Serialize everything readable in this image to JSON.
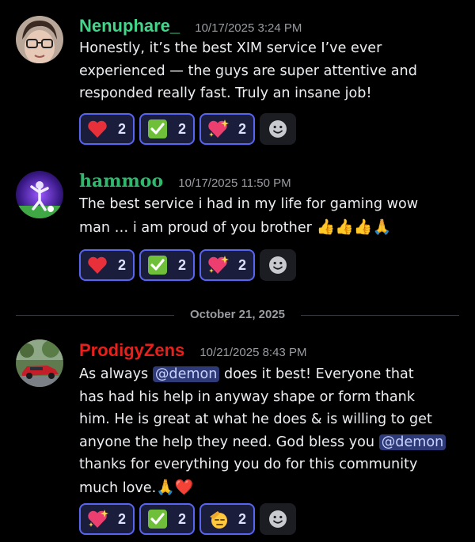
{
  "colors": {
    "background": "#000000",
    "reaction_border": "#5865f2",
    "mention_bg": "#2e3b78"
  },
  "messages": [
    {
      "username": "Nenuphare_",
      "username_color": "#43d58a",
      "timestamp": "10/17/2025 3:24 PM",
      "lines": [
        "Honestly, it’s the best XIM service I’ve ever",
        "experienced — the guys are super attentive and",
        "responded really fast. Truly an insane job!"
      ],
      "reactions": [
        {
          "icon": "heart-icon",
          "count": "2"
        },
        {
          "icon": "check-mark-icon",
          "count": "2"
        },
        {
          "icon": "sparkling-heart-icon",
          "count": "2"
        }
      ]
    },
    {
      "username": "hammoo",
      "username_color": "#2fb86e",
      "timestamp": "10/17/2025 11:50 PM",
      "lines": [
        "The best service i had in my life for gaming wow",
        "man … i am proud of you brother"
      ],
      "line_emojis": "👍👍👍🙏",
      "reactions": [
        {
          "icon": "heart-icon",
          "count": "2"
        },
        {
          "icon": "check-mark-icon",
          "count": "2"
        },
        {
          "icon": "sparkling-heart-icon",
          "count": "2"
        }
      ]
    },
    {
      "username": "ProdigyZens",
      "username_color": "#e8201c",
      "timestamp": "10/21/2025 8:43 PM",
      "text_parts": {
        "l1_before": "As always ",
        "mention1": "@demon",
        "l1_after": " does it best! Everyone that",
        "l2": "has had his help in anyway shape or form thank",
        "l3": "him. He is great at what he does & is willing to get",
        "l4_before": "anyone the help they need. God bless you ",
        "mention2": "@demon",
        "l5": "thanks for everything you do for this community",
        "l6": "much love.",
        "l6_emojis": "🙏❤️"
      },
      "reactions": [
        {
          "icon": "sparkling-heart-icon",
          "count": "2"
        },
        {
          "icon": "check-mark-icon",
          "count": "2"
        },
        {
          "icon": "saluting-face-icon",
          "count": "2"
        }
      ]
    }
  ],
  "date_divider": "October 21, 2025"
}
